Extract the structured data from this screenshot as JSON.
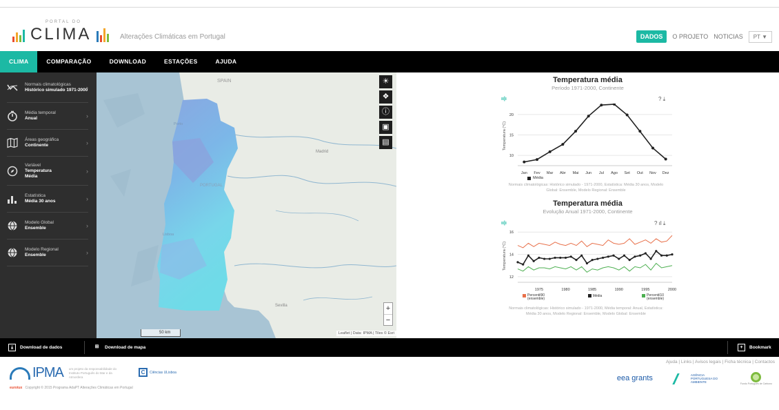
{
  "header": {
    "logo_small": "PORTAL DO",
    "logo_main": "CLIMA",
    "tagline": "Alterações Climáticas em Portugal",
    "topnav": [
      {
        "label": "DADOS",
        "active": true
      },
      {
        "label": "O PROJETO",
        "active": false
      },
      {
        "label": "NOTICIAS",
        "active": false
      }
    ],
    "lang": "PT ▼"
  },
  "nav": {
    "tabs": [
      {
        "label": "CLIMA",
        "active": true
      },
      {
        "label": "COMPARAÇÃO"
      },
      {
        "label": "DOWNLOAD"
      },
      {
        "label": "ESTAÇÕES"
      },
      {
        "label": "AJUDA"
      }
    ]
  },
  "sidebar": {
    "items": [
      {
        "label": "Normais climatológicas",
        "value": "Histórico simulado 1971-2000",
        "icon": "trend-icon"
      },
      {
        "label": "Média temporal",
        "value": "Anual",
        "icon": "clock-icon"
      },
      {
        "label": "Áreas geográfica",
        "value": "Continente",
        "icon": "map-icon"
      },
      {
        "label": "Variável",
        "value": "Temperatura Média",
        "icon": "compass-icon"
      },
      {
        "label": "Estatística",
        "value": "Média 30 anos",
        "icon": "bars-icon"
      },
      {
        "label": "Modelo Global",
        "value": "Ensemble",
        "icon": "globe-icon"
      },
      {
        "label": "Modelo Regional",
        "value": "Ensemble",
        "icon": "globe-icon"
      }
    ]
  },
  "map": {
    "labels": {
      "spain": "SPAIN",
      "portugal": "PORTUGAL",
      "madrid": "Madrid",
      "sevilla": "Sevilla",
      "lisboa": "Lisboa",
      "porto": "Porto"
    },
    "scale": "50 km",
    "attribution": "Leaflet | Data: IPMA | Tiles © Esri",
    "zoom_in": "+",
    "zoom_out": "−",
    "tools": [
      "sun-icon",
      "layers-icon",
      "info-icon",
      "image-download-icon",
      "legend-icon"
    ],
    "colors": {
      "sea": "#a8c4d4",
      "land": "#e9ece6",
      "portugal_light": "#78d6ea",
      "portugal_mid": "#7cb7e8",
      "portugal_dark": "#8aa6e0"
    }
  },
  "charts": {
    "c1": {
      "title": "Temperatura média",
      "subtitle": "Período 1971-2000, Continente",
      "icons": "? ⤓",
      "legend": "Média",
      "note": "Normais climatológicas: Histórico simulado - 1971-2000, Estatística: Média 30 anos, Modelo Global: Ensemble, Modelo Regional: Ensemble"
    },
    "c2": {
      "title": "Temperatura média",
      "subtitle": "Evolução Anual 1971-2000, Continente",
      "icons": "? ıl ⤓",
      "legend": [
        "Percentil90 (ensemble)",
        "Média",
        "Percentil10 (ensemble)"
      ],
      "note": "Normais climatológicas: Histórico simulado - 1971-2000, Média temporal: Anual, Estatística: Média 30 anos, Modelo Regional: Ensemble, Modelo Global: Ensemble"
    }
  },
  "chart_data": [
    {
      "type": "line",
      "title": "Temperatura média",
      "subtitle": "Período 1971-2000, Continente",
      "ylabel": "Temperatura (°C)",
      "categories": [
        "Jan",
        "Fev",
        "Mar",
        "Abr",
        "Mai",
        "Jun",
        "Jul",
        "Ago",
        "Set",
        "Out",
        "Nov",
        "Dez"
      ],
      "yticks": [
        10,
        15,
        20
      ],
      "ylim": [
        7.5,
        22
      ],
      "series": [
        {
          "name": "Média",
          "color": "#222222",
          "values": [
            8.4,
            9.0,
            10.9,
            12.7,
            15.9,
            19.6,
            22.3,
            22.5,
            19.9,
            15.9,
            11.8,
            9.1
          ]
        }
      ]
    },
    {
      "type": "line",
      "title": "Temperatura média",
      "subtitle": "Evolução Anual 1971-2000, Continente",
      "ylabel": "Temperatura (°C)",
      "x": [
        1971,
        1972,
        1973,
        1974,
        1975,
        1976,
        1977,
        1978,
        1979,
        1980,
        1981,
        1982,
        1983,
        1984,
        1985,
        1986,
        1987,
        1988,
        1989,
        1990,
        1991,
        1992,
        1993,
        1994,
        1995,
        1996,
        1997,
        1998,
        1999,
        2000
      ],
      "xticks": [
        1975,
        1980,
        1985,
        1990,
        1995,
        2000
      ],
      "yticks": [
        12,
        14,
        16
      ],
      "ylim": [
        11.5,
        16.2
      ],
      "series": [
        {
          "name": "Percentil90 (ensemble)",
          "color": "#e8704a",
          "values": [
            14.8,
            14.6,
            15.0,
            14.7,
            15.0,
            14.9,
            14.8,
            15.1,
            14.9,
            14.8,
            15.0,
            14.8,
            15.2,
            14.7,
            15.0,
            14.9,
            14.8,
            15.3,
            15.0,
            14.9,
            15.0,
            15.4,
            14.9,
            15.1,
            15.3,
            15.0,
            15.4,
            15.1,
            15.2,
            15.7
          ]
        },
        {
          "name": "Média",
          "color": "#222222",
          "values": [
            13.3,
            13.1,
            13.9,
            13.4,
            13.7,
            13.6,
            13.6,
            13.7,
            13.7,
            13.7,
            13.8,
            13.5,
            13.9,
            13.2,
            13.5,
            13.6,
            13.7,
            13.8,
            13.9,
            13.6,
            13.9,
            13.5,
            13.8,
            13.9,
            14.1,
            13.6,
            14.3,
            13.9,
            13.9,
            14.0
          ]
        },
        {
          "name": "Percentil10 (ensemble)",
          "color": "#4caf50",
          "values": [
            12.7,
            12.5,
            12.9,
            12.6,
            12.8,
            12.8,
            12.7,
            12.9,
            12.8,
            12.7,
            12.9,
            12.6,
            12.9,
            12.4,
            12.7,
            12.6,
            12.8,
            12.9,
            12.8,
            12.6,
            12.9,
            12.5,
            12.9,
            12.8,
            13.1,
            12.6,
            13.2,
            12.8,
            12.9,
            13.0
          ]
        }
      ]
    }
  ],
  "footer": {
    "download_data": "Download de dados",
    "download_map": "Download de mapa",
    "bookmark": "Bookmark",
    "ipma": "IPMA",
    "ipma_resp": "um projeto da responsabilidade do Instituto Português do Mar e da Atmosfera",
    "ciencias": "Ciências ULisboa",
    "eurotux": "eurotux",
    "credit": "Copyright © 2015 Programa AdaPT Alterações Climáticas em Portugal",
    "links": "Ajuda | Links | Avisos legais | Ficha técnica | Contactos",
    "eea": "eea grants",
    "apa": "AGÊNCIA PORTUGUESA DO AMBIENTE",
    "fundo": "Fundo Português de Carbono"
  }
}
